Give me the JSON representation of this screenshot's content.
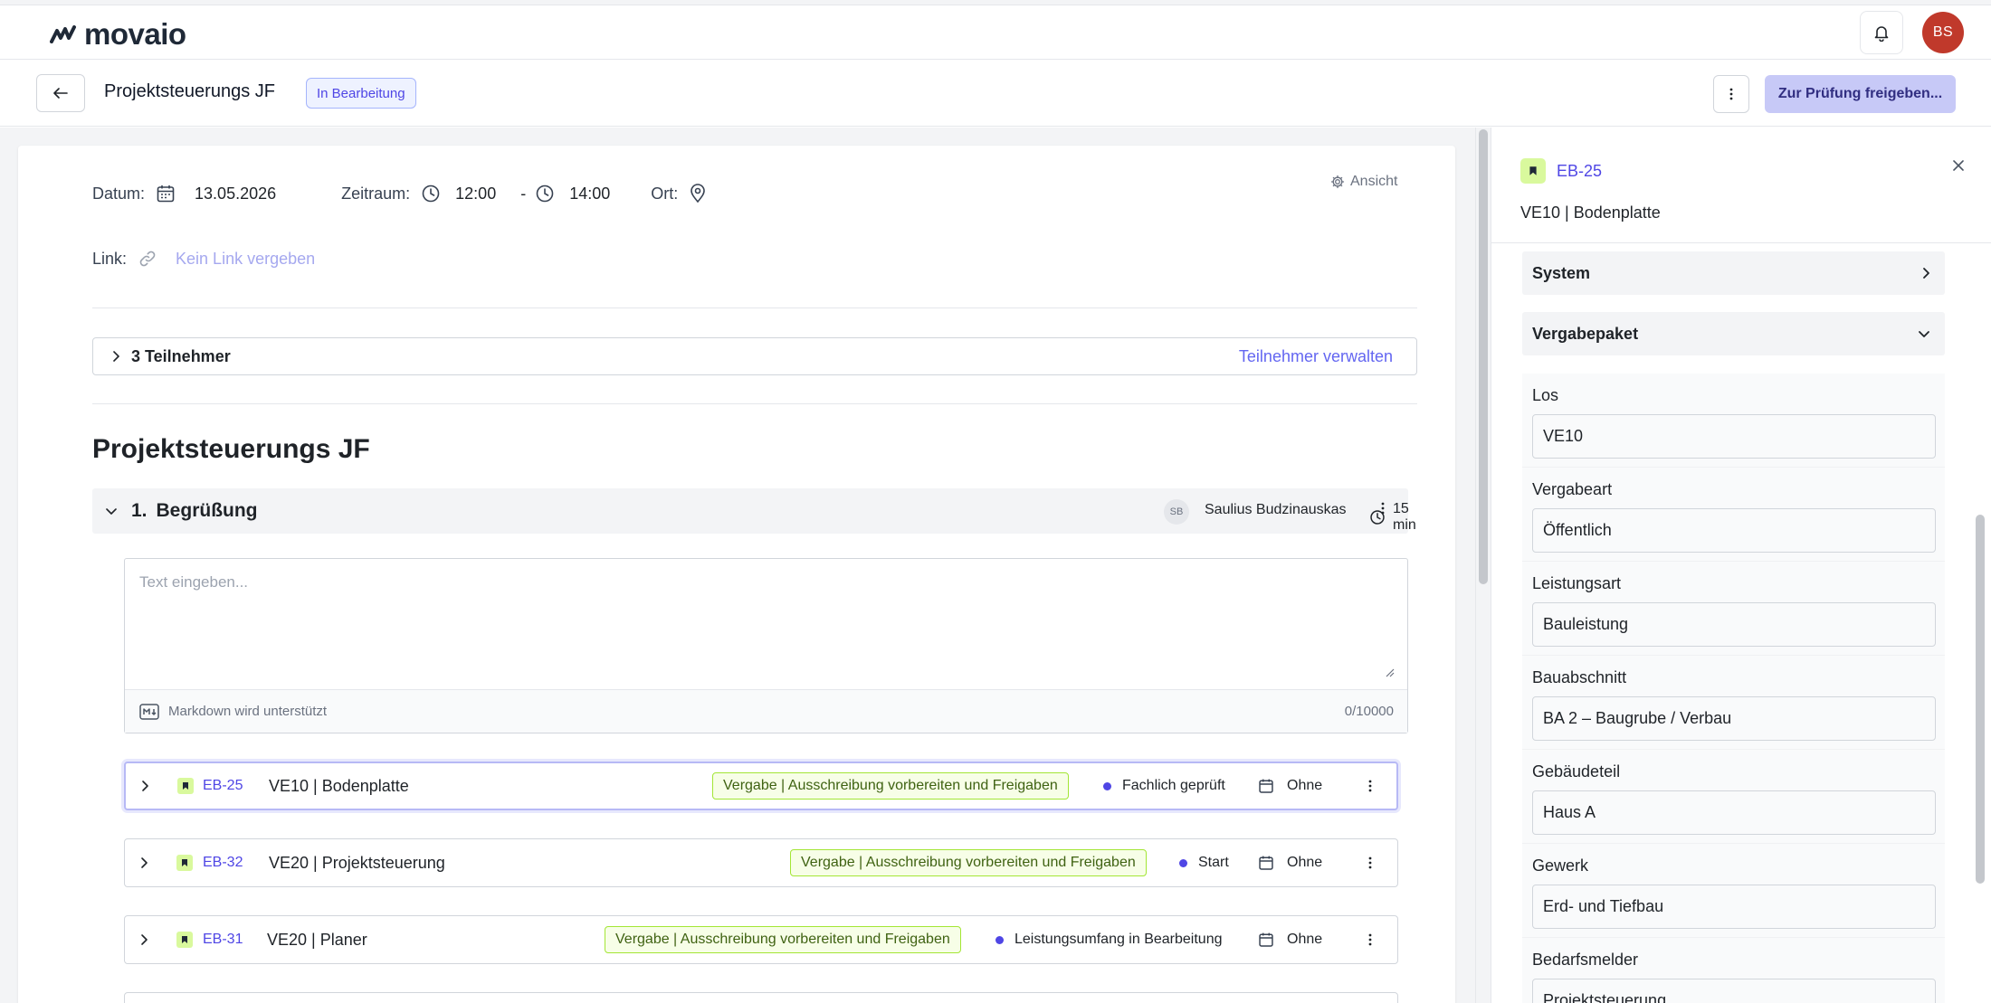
{
  "app": {
    "logo_text": "movaio",
    "avatar_initials": "BS"
  },
  "header": {
    "title": "Projektsteuerungs JF",
    "status_badge": "In Bearbeitung",
    "primary_action": "Zur Prüfung freigeben..."
  },
  "meeting": {
    "date_label": "Datum:",
    "date_value": "13.05.2026",
    "time_label": "Zeitraum:",
    "time_start": "12:00",
    "time_separator": "-",
    "time_end": "14:00",
    "place_label": "Ort:",
    "link_label": "Link:",
    "link_placeholder": "Kein Link vergeben",
    "view_label": "Ansicht"
  },
  "participants": {
    "label": "3 Teilnehmer",
    "manage_label": "Teilnehmer verwalten"
  },
  "document": {
    "heading": "Projektsteuerungs JF"
  },
  "agenda": {
    "number": "1.",
    "title": "Begrüßung",
    "presenter_initials": "SB",
    "presenter_name": "Saulius Budzinauskas",
    "duration": "15 min",
    "editor_placeholder": "Text eingeben...",
    "markdown_hint": "Markdown wird unterstützt",
    "char_count": "0/10000"
  },
  "items": [
    {
      "id": "EB-25",
      "title": "VE10 | Bodenplatte",
      "tag": "Vergabe | Ausschreibung vorbereiten und Freigaben",
      "status": "Fachlich geprüft",
      "due": "Ohne"
    },
    {
      "id": "EB-32",
      "title": "VE20 | Projektsteuerung",
      "tag": "Vergabe | Ausschreibung vorbereiten und Freigaben",
      "status": "Start",
      "due": "Ohne"
    },
    {
      "id": "EB-31",
      "title": "VE20 | Planer",
      "tag": "Vergabe | Ausschreibung vorbereiten und Freigaben",
      "status": "Leistungsumfang in Bearbeitung",
      "due": "Ohne"
    }
  ],
  "panel": {
    "id": "EB-25",
    "title": "VE10 | Bodenplatte",
    "sections": [
      {
        "label": "System",
        "expanded": false
      },
      {
        "label": "Vergabepaket",
        "expanded": true
      }
    ],
    "fields": [
      {
        "label": "Los",
        "value": "VE10"
      },
      {
        "label": "Vergabeart",
        "value": "Öffentlich"
      },
      {
        "label": "Leistungsart",
        "value": "Bauleistung"
      },
      {
        "label": "Bauabschnitt",
        "value": "BA 2 – Baugrube / Verbau"
      },
      {
        "label": "Gebäudeteil",
        "value": "Haus A"
      },
      {
        "label": "Gewerk",
        "value": "Erd- und Tiefbau"
      },
      {
        "label": "Bedarfsmelder",
        "value": "Projektsteuerung"
      }
    ]
  },
  "colors": {
    "accent": "#4f46e5",
    "avatar_bg": "#c0392b",
    "primary_button_bg": "#c7c9f7",
    "tag_border": "#a3e635"
  }
}
